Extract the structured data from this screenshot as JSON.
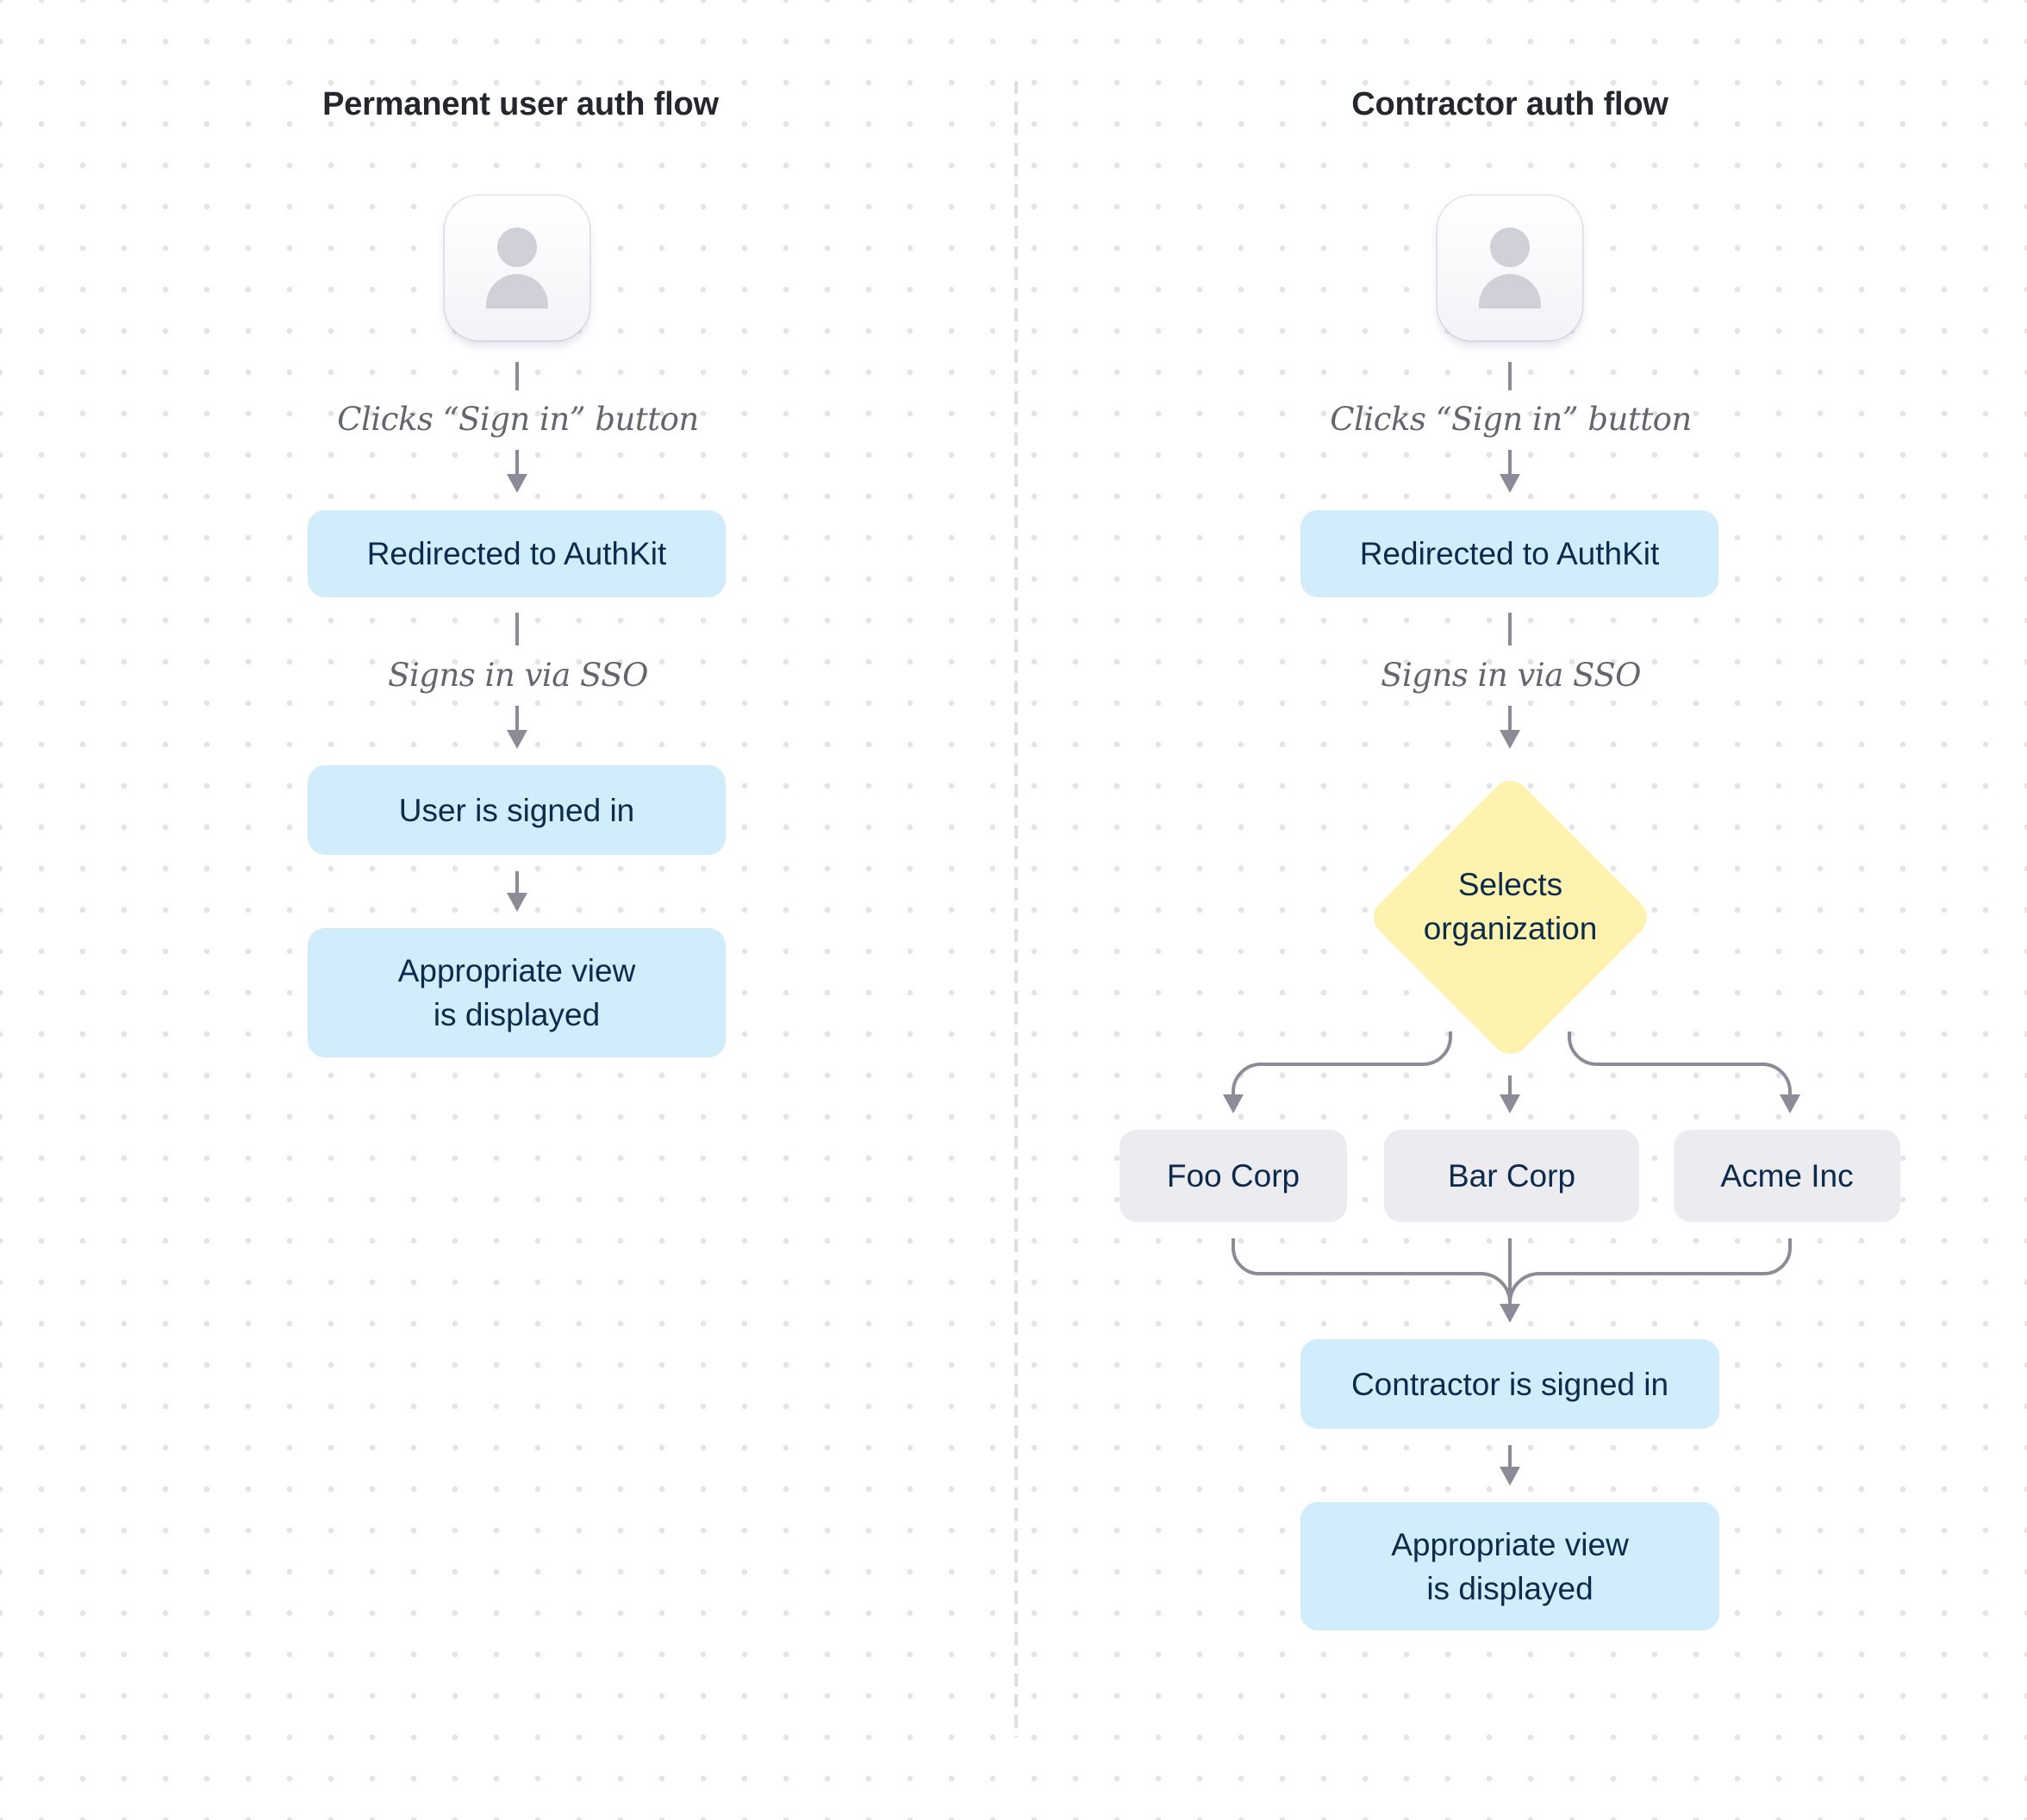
{
  "colors": {
    "process_node": "#d1ecfb",
    "decision_node": "#fdf2ae",
    "option_node": "#ebebf0",
    "connector": "#8b8c98",
    "node_text": "#0c2a4b",
    "annotation_text": "#64666f",
    "title_text": "#24272e"
  },
  "left_flow": {
    "title": "Permanent user auth flow",
    "start_icon": "user-avatar-icon",
    "steps": [
      {
        "type": "annotation",
        "text": "Clicks “Sign in” button"
      },
      {
        "type": "process",
        "text": "Redirected to AuthKit"
      },
      {
        "type": "annotation",
        "text": "Signs in via SSO"
      },
      {
        "type": "process",
        "text": "User is signed in"
      },
      {
        "type": "process",
        "text": "Appropriate view is displayed"
      }
    ]
  },
  "right_flow": {
    "title": "Contractor auth flow",
    "start_icon": "user-avatar-icon",
    "steps": [
      {
        "type": "annotation",
        "text": "Clicks “Sign in” button"
      },
      {
        "type": "process",
        "text": "Redirected to AuthKit"
      },
      {
        "type": "annotation",
        "text": "Signs in via SSO"
      },
      {
        "type": "decision",
        "text": "Selects organization"
      },
      {
        "type": "options",
        "items": [
          "Foo Corp",
          "Bar Corp",
          "Acme Inc"
        ]
      },
      {
        "type": "process",
        "text": "Contractor is signed in"
      },
      {
        "type": "process",
        "text": "Appropriate view is displayed"
      }
    ]
  }
}
